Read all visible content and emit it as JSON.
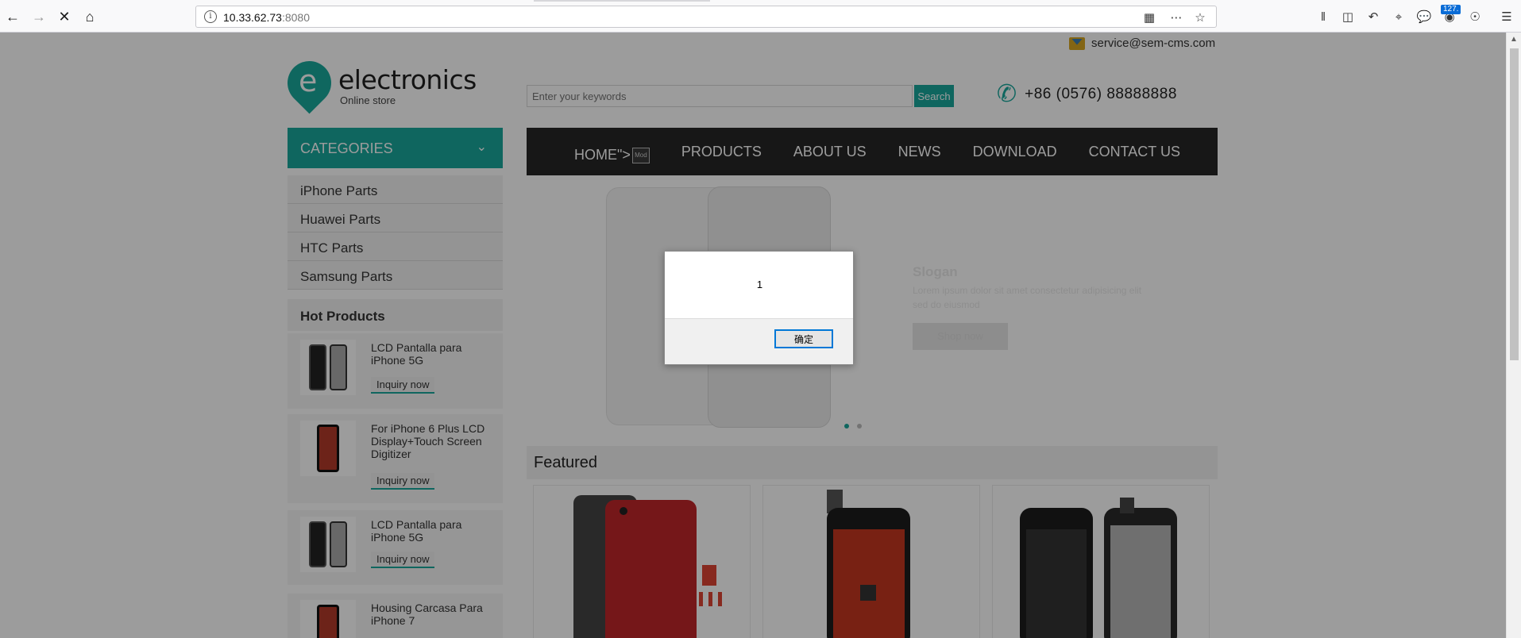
{
  "browser": {
    "url_host": "10.33.62.73",
    "url_port": ":8080",
    "notification_count": "127."
  },
  "header": {
    "email": "service@sem-cms.com",
    "logo_letter": "e",
    "logo_name": "electronics",
    "logo_sub": "Online store",
    "search_placeholder": "Enter your keywords",
    "search_button": "Search",
    "phone": "+86  (0576)  88888888"
  },
  "categories": {
    "header": "CATEGORIES",
    "items": [
      "iPhone Parts",
      "Huawei Parts",
      "HTC Parts",
      "Samsung Parts"
    ]
  },
  "nav": {
    "home": "HOME\">",
    "broken_image_alt": "Mod",
    "items": [
      "PRODUCTS",
      "ABOUT US",
      "NEWS",
      "DOWNLOAD",
      "CONTACT US"
    ]
  },
  "hot_products": {
    "title": "Hot Products",
    "items": [
      {
        "title": "LCD Pantalla para iPhone 5G",
        "action": "Inquiry now"
      },
      {
        "title": "For iPhone 6 Plus LCD Display+Touch Screen Digitizer",
        "action": "Inquiry now"
      },
      {
        "title": "LCD Pantalla para iPhone 5G",
        "action": "Inquiry now"
      },
      {
        "title": "Housing Carcasa Para iPhone 7",
        "action": ""
      }
    ]
  },
  "banner": {
    "title": "Slogan",
    "text": "Lorem ipsum dolor sit amet consectetur adipisicing elit sed do eiusmod",
    "button": "Shop now"
  },
  "featured": {
    "title": "Featured"
  },
  "dialog": {
    "message": "1",
    "ok_button": "确定"
  },
  "colors": {
    "accent": "#19a79b",
    "nav_bg": "#262626",
    "overlay": "rgba(0,0,0,0.39)"
  }
}
